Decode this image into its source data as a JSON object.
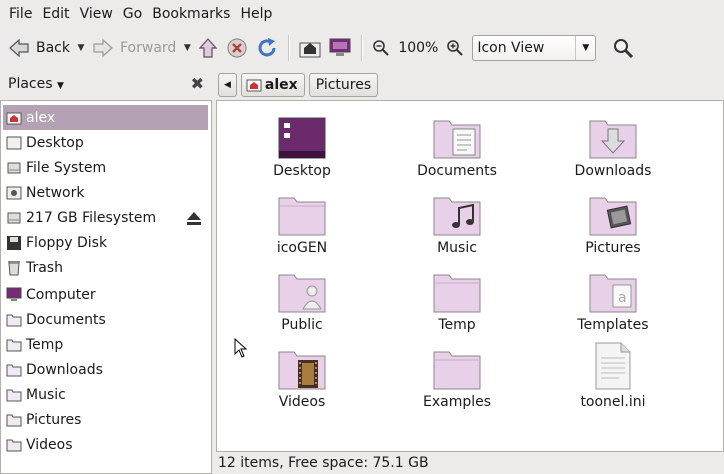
{
  "menubar": {
    "items": [
      "File",
      "Edit",
      "View",
      "Go",
      "Bookmarks",
      "Help"
    ]
  },
  "toolbar": {
    "back_label": "Back",
    "forward_label": "Forward",
    "zoom_value": "100%",
    "view_mode": "Icon View"
  },
  "sidebar": {
    "header": "Places",
    "items": [
      {
        "label": "alex",
        "icon": "home-folder-icon",
        "selected": true
      },
      {
        "label": "Desktop",
        "icon": "desktop-icon"
      },
      {
        "label": "File System",
        "icon": "drive-icon"
      },
      {
        "label": "Network",
        "icon": "network-icon"
      },
      {
        "label": "217 GB Filesystem",
        "icon": "drive-icon"
      },
      {
        "label": "Floppy Disk",
        "icon": "floppy-icon"
      },
      {
        "label": "Trash",
        "icon": "trash-icon"
      },
      {
        "label": "Computer",
        "icon": "computer-icon"
      },
      {
        "label": "Documents",
        "icon": "folder-icon"
      },
      {
        "label": "Temp",
        "icon": "folder-icon"
      },
      {
        "label": "Downloads",
        "icon": "folder-icon"
      },
      {
        "label": "Music",
        "icon": "folder-icon"
      },
      {
        "label": "Pictures",
        "icon": "folder-icon"
      },
      {
        "label": "Videos",
        "icon": "folder-icon"
      }
    ]
  },
  "pathbar": {
    "crumbs": [
      "alex",
      "Pictures"
    ]
  },
  "files": [
    {
      "name": "Desktop",
      "icon": "desktop-folder-icon"
    },
    {
      "name": "Documents",
      "icon": "documents-folder-icon"
    },
    {
      "name": "Downloads",
      "icon": "downloads-folder-icon"
    },
    {
      "name": "icoGEN",
      "icon": "folder-icon"
    },
    {
      "name": "Music",
      "icon": "music-folder-icon"
    },
    {
      "name": "Pictures",
      "icon": "pictures-folder-icon"
    },
    {
      "name": "Public",
      "icon": "public-folder-icon"
    },
    {
      "name": "Temp",
      "icon": "folder-icon"
    },
    {
      "name": "Templates",
      "icon": "templates-folder-icon"
    },
    {
      "name": "Videos",
      "icon": "videos-folder-icon"
    },
    {
      "name": "Examples",
      "icon": "folder-icon"
    },
    {
      "name": "toonel.ini",
      "icon": "text-file-icon"
    }
  ],
  "status": "12 items, Free space: 75.1 GB",
  "colors": {
    "selection": "#b4a2b4",
    "folder_tint": "#e8c8e8",
    "accent_purple": "#7a2a7a"
  }
}
